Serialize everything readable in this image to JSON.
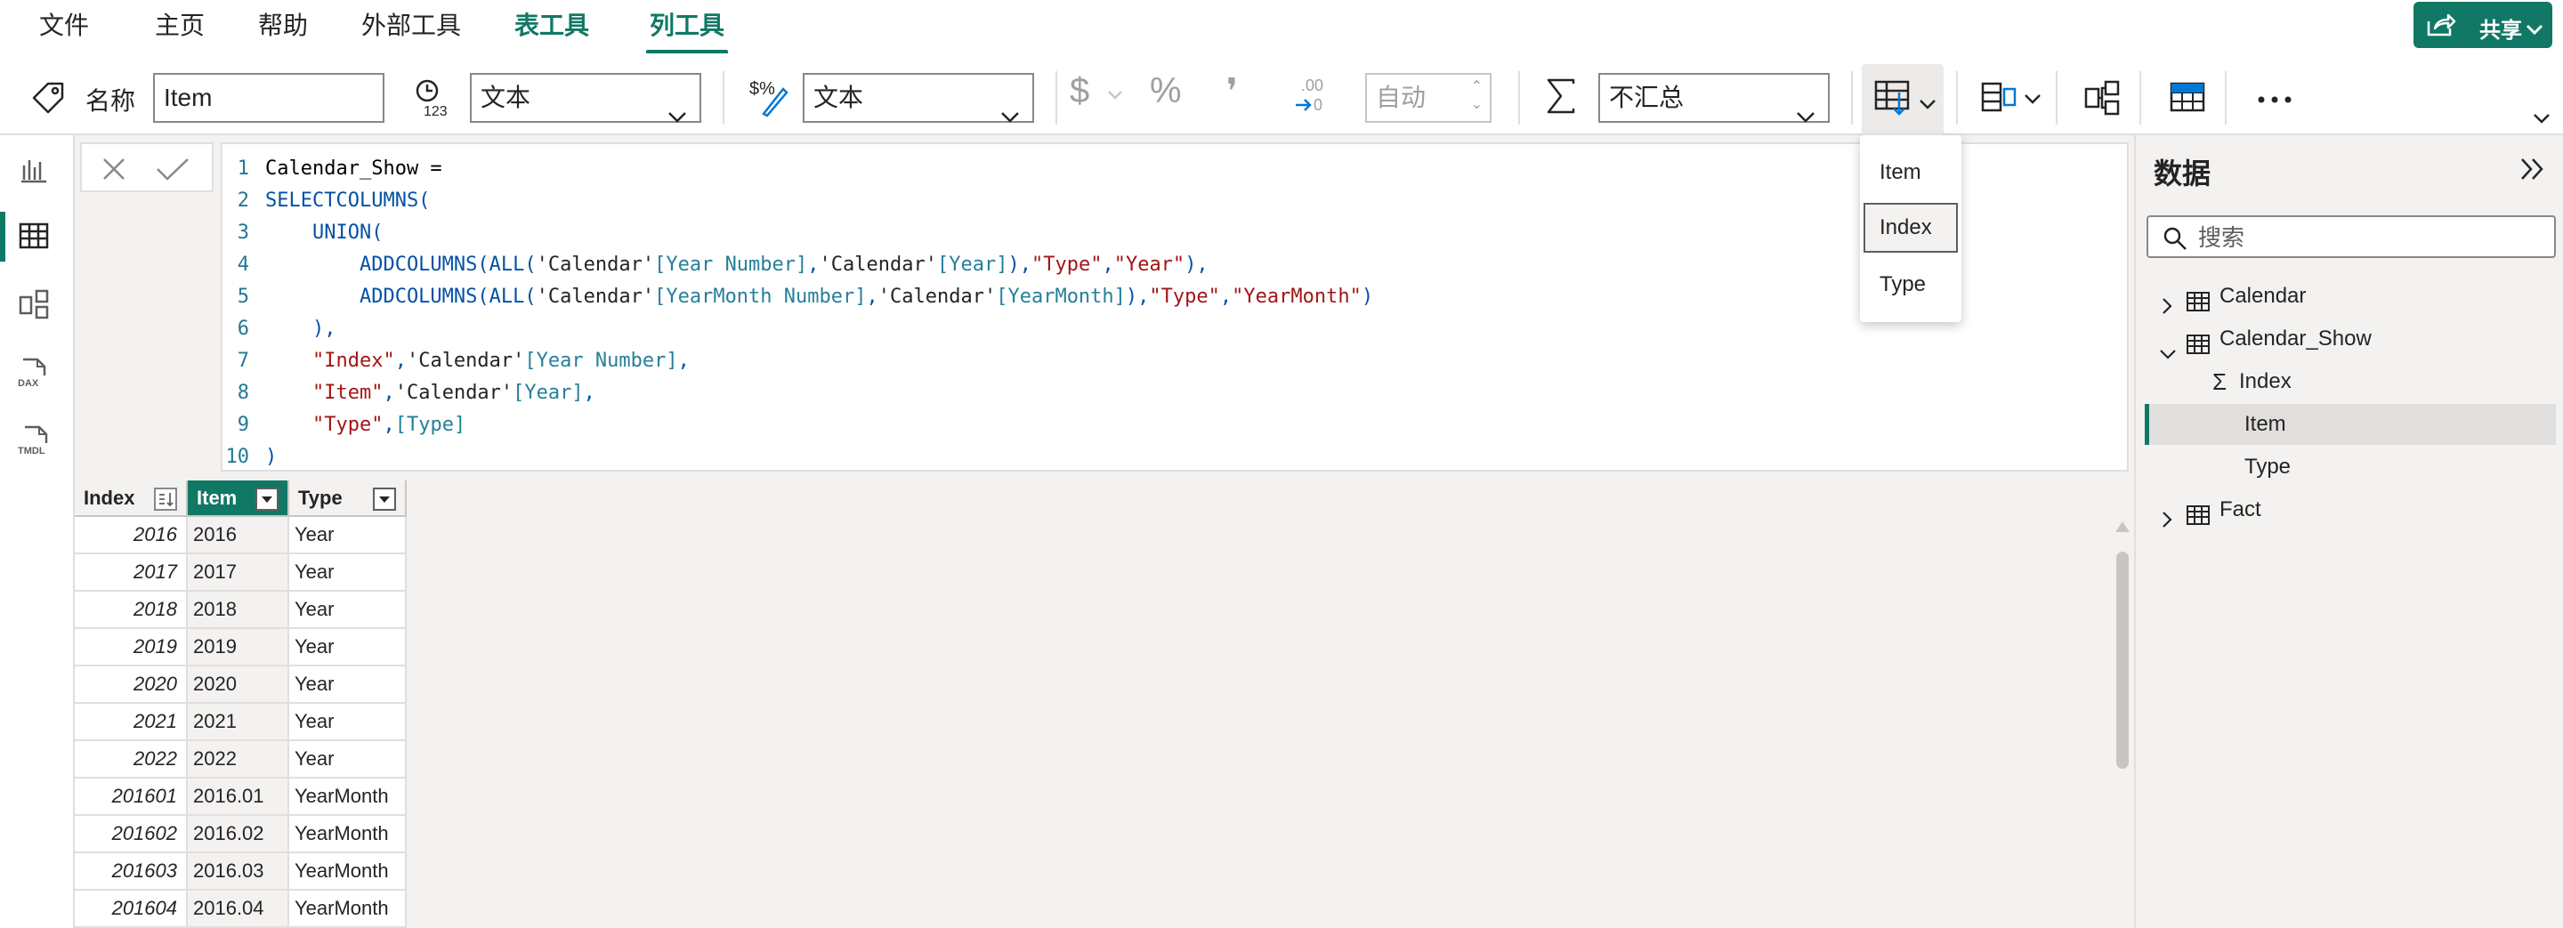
{
  "menu": {
    "tabs": [
      "文件",
      "主页",
      "帮助",
      "外部工具",
      "表工具",
      "列工具"
    ],
    "share_label": "共享"
  },
  "ribbon": {
    "name_label": "名称",
    "name_value": "Item",
    "data_type_value": "文本",
    "format_value": "文本",
    "decimal_places_placeholder": "自动",
    "summarization_value": "不汇总",
    "currency_symbol": "$",
    "percent_symbol": "%",
    "comma_symbol": "❜",
    "decimal_symbol": ".00"
  },
  "left_rail": {
    "items": [
      "report-view",
      "table-view",
      "model-view",
      "DAX",
      "TMDL"
    ]
  },
  "formula": {
    "lines": [
      "Calendar_Show =",
      "SELECTCOLUMNS(",
      "    UNION(",
      "        ADDCOLUMNS(ALL('Calendar'[Year Number],'Calendar'[Year]),\"Type\",\"Year\"),",
      "        ADDCOLUMNS(ALL('Calendar'[YearMonth Number],'Calendar'[YearMonth]),\"Type\",\"YearMonth\")",
      "    ),",
      "    \"Index\",'Calendar'[Year Number],",
      "    \"Item\",'Calendar'[Year],",
      "    \"Type\",[Type]",
      ")"
    ]
  },
  "sort_menu": {
    "options": [
      "Item",
      "Index",
      "Type"
    ],
    "hovered": "Index"
  },
  "table": {
    "columns": [
      "Index",
      "Item",
      "Type"
    ],
    "rows": [
      [
        "2016",
        "2016",
        "Year"
      ],
      [
        "2017",
        "2017",
        "Year"
      ],
      [
        "2018",
        "2018",
        "Year"
      ],
      [
        "2019",
        "2019",
        "Year"
      ],
      [
        "2020",
        "2020",
        "Year"
      ],
      [
        "2021",
        "2021",
        "Year"
      ],
      [
        "2022",
        "2022",
        "Year"
      ],
      [
        "201601",
        "2016.01",
        "YearMonth"
      ],
      [
        "201602",
        "2016.02",
        "YearMonth"
      ],
      [
        "201603",
        "2016.03",
        "YearMonth"
      ],
      [
        "201604",
        "2016.04",
        "YearMonth"
      ]
    ]
  },
  "data_pane": {
    "title": "数据",
    "search_placeholder": "搜索",
    "tables": [
      "Calendar",
      "Calendar_Show",
      "Fact"
    ],
    "fields": [
      "Index",
      "Item",
      "Type"
    ],
    "selected_field": "Item"
  },
  "colors": {
    "accent": "#117865",
    "keyword": "#0451a5",
    "string": "#a31515",
    "column_ref": "#267f99"
  }
}
